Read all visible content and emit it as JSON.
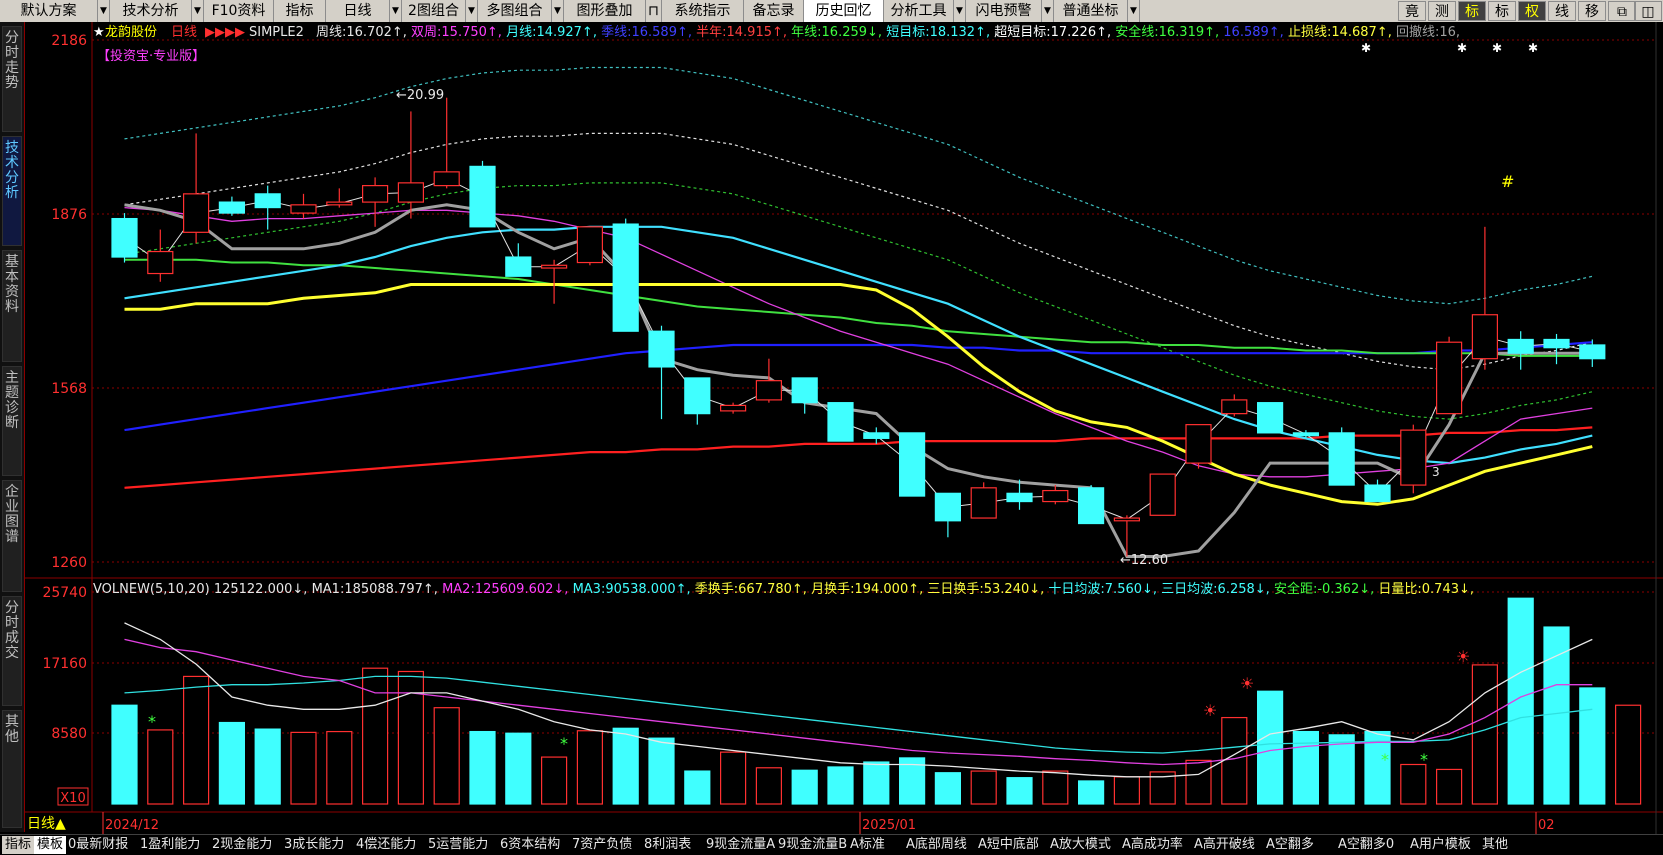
{
  "toolbar": {
    "items": [
      "默认方案",
      "技术分析",
      "F10资料",
      "指标",
      "日线",
      "2图组合",
      "多图组合",
      "图形叠加",
      "系统指示",
      "备忘录",
      "历史回忆",
      "分析工具",
      "闪电预警",
      "普通坐标"
    ],
    "lock_icon": "lock-icon",
    "right_items": [
      "竟",
      "测",
      "标",
      "标",
      "权",
      "线",
      "移"
    ],
    "restore_icon": "restore-icon",
    "split_icon": "split-icon"
  },
  "left_nav": [
    "分时走势",
    "技术分析",
    "基本资料",
    "主题诊断",
    "企业图谱",
    "分时成交",
    "其他"
  ],
  "stock": {
    "name": "龙韵股份",
    "period": "日线",
    "flags": "▶▶▶▶",
    "indicator": "SIMPLE2",
    "badge": "【投资宝·专业版】"
  },
  "upper_legend": [
    {
      "label": "周线",
      "value": "16.702",
      "dir": "↑",
      "color": "#e8e8e8"
    },
    {
      "label": "双周",
      "value": "15.750",
      "dir": "↑",
      "color": "#ff40ff"
    },
    {
      "label": "月线",
      "value": "14.927",
      "dir": "↑",
      "color": "#40ffff"
    },
    {
      "label": "季线",
      "value": "16.589",
      "dir": "↑",
      "color": "#4040ff"
    },
    {
      "label": "半年",
      "value": "14.915",
      "dir": "↑",
      "color": "#ff4040"
    },
    {
      "label": "年线",
      "value": "16.259",
      "dir": "↓",
      "color": "#40ff40"
    },
    {
      "label": "短目标",
      "value": "18.132",
      "dir": "↑",
      "color": "#40ffff"
    },
    {
      "label": "超短目标",
      "value": "17.226",
      "dir": "↑",
      "color": "#ffffff"
    },
    {
      "label": "安全线",
      "value": "16.319",
      "dir": "↑",
      "color": "#40ff40"
    },
    {
      "label": "",
      "value": "16.589",
      "dir": "↑",
      "color": "#4040ff"
    },
    {
      "label": "止损线",
      "value": "14.687",
      "dir": "↑",
      "color": "#ffff40"
    },
    {
      "label": "回撤线",
      "value": "16",
      "dir": "",
      "color": "#a0a0a0"
    }
  ],
  "lower_legend": [
    {
      "label": "VOLNEW(5,10,20)",
      "value": "",
      "dir": "",
      "color": "#e8e8e8"
    },
    {
      "label": "",
      "value": "125122.000",
      "dir": "↓",
      "color": "#e8e8e8"
    },
    {
      "label": "MA1",
      "value": "185088.797",
      "dir": "↑",
      "color": "#e8e8e8"
    },
    {
      "label": "MA2",
      "value": "125609.602",
      "dir": "↓",
      "color": "#ff40ff"
    },
    {
      "label": "MA3",
      "value": "90538.000",
      "dir": "↑",
      "color": "#40ffff"
    },
    {
      "label": "季换手",
      "value": "667.780",
      "dir": "↑",
      "color": "#ffff40"
    },
    {
      "label": "月换手",
      "value": "194.000",
      "dir": "↑",
      "color": "#ffff40"
    },
    {
      "label": "三日换手",
      "value": "53.240",
      "dir": "↓",
      "color": "#ffff40"
    },
    {
      "label": "十日均波",
      "value": "7.560",
      "dir": "↓",
      "color": "#40ffff"
    },
    {
      "label": "三日均波",
      "value": "6.258",
      "dir": "↓",
      "color": "#40ffff"
    },
    {
      "label": "安全距",
      "value": "-0.362",
      "dir": "↓",
      "color": "#40ff40"
    },
    {
      "label": "日量比",
      "value": "0.743",
      "dir": "↓",
      "color": "#ffff40"
    }
  ],
  "axis": {
    "price_ticks": [
      "2186",
      "1876",
      "1568",
      "1260"
    ],
    "volume_ticks": [
      "25740",
      "17160",
      "8580"
    ],
    "volume_unit": "X10",
    "period_label": "日线▲",
    "date_labels": [
      "2024/12",
      "2025/01",
      "02"
    ]
  },
  "annotations": {
    "high": "20.99",
    "low": "12.60",
    "count": "3",
    "hash": "#"
  },
  "colors": {
    "up": "#ff3030",
    "down": "#40ffff",
    "grid": "#8b0000",
    "axis_text": "#ff3030"
  },
  "chart_data": {
    "type": "candlestick",
    "price_range": [
      12.5,
      22.0
    ],
    "volume_range": [
      0,
      26000
    ],
    "candles": [
      {
        "o": 18.75,
        "h": 18.85,
        "l": 17.95,
        "c": 18.05
      },
      {
        "o": 17.75,
        "h": 18.55,
        "l": 17.6,
        "c": 18.15
      },
      {
        "o": 18.5,
        "h": 20.3,
        "l": 18.3,
        "c": 19.2
      },
      {
        "o": 19.05,
        "h": 19.15,
        "l": 18.8,
        "c": 18.85
      },
      {
        "o": 19.2,
        "h": 19.35,
        "l": 18.55,
        "c": 18.95
      },
      {
        "o": 18.85,
        "h": 19.2,
        "l": 18.75,
        "c": 19.0
      },
      {
        "o": 19.0,
        "h": 19.3,
        "l": 18.95,
        "c": 19.05
      },
      {
        "o": 19.05,
        "h": 19.5,
        "l": 18.6,
        "c": 19.35
      },
      {
        "o": 19.05,
        "h": 20.7,
        "l": 18.75,
        "c": 19.4
      },
      {
        "o": 19.35,
        "h": 20.95,
        "l": 19.3,
        "c": 19.6
      },
      {
        "o": 19.7,
        "h": 19.8,
        "l": 18.8,
        "c": 18.6
      },
      {
        "o": 18.05,
        "h": 18.3,
        "l": 17.7,
        "c": 17.7
      },
      {
        "o": 17.85,
        "h": 18.0,
        "l": 17.2,
        "c": 17.9
      },
      {
        "o": 17.95,
        "h": 18.6,
        "l": 17.9,
        "c": 18.6
      },
      {
        "o": 18.65,
        "h": 18.75,
        "l": 16.7,
        "c": 16.7
      },
      {
        "o": 16.7,
        "h": 16.8,
        "l": 15.1,
        "c": 16.05
      },
      {
        "o": 15.85,
        "h": 15.85,
        "l": 15.0,
        "c": 15.2
      },
      {
        "o": 15.25,
        "h": 15.4,
        "l": 15.2,
        "c": 15.35
      },
      {
        "o": 15.45,
        "h": 16.2,
        "l": 15.4,
        "c": 15.8
      },
      {
        "o": 15.85,
        "h": 15.85,
        "l": 15.2,
        "c": 15.4
      },
      {
        "o": 15.4,
        "h": 15.4,
        "l": 14.7,
        "c": 14.7
      },
      {
        "o": 14.85,
        "h": 14.95,
        "l": 14.65,
        "c": 14.75
      },
      {
        "o": 14.85,
        "h": 14.85,
        "l": 13.7,
        "c": 13.7
      },
      {
        "o": 13.75,
        "h": 13.75,
        "l": 12.95,
        "c": 13.25
      },
      {
        "o": 13.3,
        "h": 13.95,
        "l": 13.3,
        "c": 13.85
      },
      {
        "o": 13.75,
        "h": 14.0,
        "l": 13.45,
        "c": 13.6
      },
      {
        "o": 13.6,
        "h": 13.9,
        "l": 13.55,
        "c": 13.8
      },
      {
        "o": 13.85,
        "h": 13.9,
        "l": 13.2,
        "c": 13.2
      },
      {
        "o": 13.25,
        "h": 13.35,
        "l": 12.6,
        "c": 13.3
      },
      {
        "o": 13.35,
        "h": 14.1,
        "l": 13.35,
        "c": 14.1
      },
      {
        "o": 14.3,
        "h": 15.0,
        "l": 14.2,
        "c": 15.0
      },
      {
        "o": 15.2,
        "h": 15.55,
        "l": 15.15,
        "c": 15.45
      },
      {
        "o": 15.4,
        "h": 15.4,
        "l": 14.85,
        "c": 14.85
      },
      {
        "o": 14.85,
        "h": 14.9,
        "l": 14.75,
        "c": 14.8
      },
      {
        "o": 14.85,
        "h": 14.95,
        "l": 13.9,
        "c": 13.9
      },
      {
        "o": 13.9,
        "h": 14.0,
        "l": 13.7,
        "c": 13.6
      },
      {
        "o": 13.9,
        "h": 15.0,
        "l": 13.75,
        "c": 14.9
      },
      {
        "o": 15.2,
        "h": 16.6,
        "l": 15.2,
        "c": 16.5
      },
      {
        "o": 16.2,
        "h": 18.6,
        "l": 16.0,
        "c": 17.0
      },
      {
        "o": 16.55,
        "h": 16.7,
        "l": 16.0,
        "c": 16.3
      },
      {
        "o": 16.55,
        "h": 16.65,
        "l": 16.1,
        "c": 16.4
      },
      {
        "o": 16.45,
        "h": 16.55,
        "l": 16.05,
        "c": 16.2
      }
    ],
    "volumes": [
      12000,
      9000,
      15500,
      9900,
      9100,
      8700,
      8800,
      16500,
      16100,
      11700,
      8800,
      8600,
      5700,
      8900,
      9200,
      8000,
      4000,
      6300,
      4400,
      4100,
      4500,
      5100,
      5600,
      3800,
      4000,
      3200,
      4000,
      2800,
      3300,
      3900,
      5300,
      10500,
      13700,
      8800,
      8400,
      8800,
      4800,
      4200,
      16900,
      25000,
      21500,
      14100,
      12000
    ],
    "ma_weekly": [
      19.0,
      18.9,
      18.7,
      18.2,
      18.2,
      18.2,
      18.3,
      18.5,
      18.9,
      19.0,
      18.9,
      18.5,
      18.2,
      18.4,
      17.7,
      16.2,
      16.0,
      15.9,
      15.85,
      15.4,
      15.3,
      15.2,
      14.6,
      14.2,
      14.05,
      13.95,
      13.9,
      13.85,
      12.6,
      12.6,
      12.7,
      13.4,
      14.3,
      14.3,
      14.3,
      14.3,
      14.0,
      15.0,
      16.3,
      16.3,
      16.3,
      16.3
    ],
    "ma_biweekly": [
      18.95,
      18.9,
      18.8,
      18.7,
      18.75,
      18.75,
      18.8,
      18.85,
      18.9,
      18.9,
      18.85,
      18.8,
      18.7,
      18.55,
      18.4,
      18.1,
      17.8,
      17.5,
      17.2,
      16.95,
      16.7,
      16.5,
      16.3,
      16.1,
      15.8,
      15.5,
      15.2,
      14.95,
      14.7,
      14.5,
      14.25,
      14.1,
      14.05,
      14.05,
      14.1,
      14.15,
      14.2,
      14.3,
      14.7,
      15.1,
      15.2,
      15.3
    ],
    "ma_monthly": [
      17.3,
      17.4,
      17.5,
      17.6,
      17.7,
      17.8,
      17.9,
      18.05,
      18.25,
      18.4,
      18.5,
      18.55,
      18.55,
      18.6,
      18.6,
      18.6,
      18.5,
      18.4,
      18.2,
      18.0,
      17.8,
      17.6,
      17.4,
      17.2,
      16.9,
      16.6,
      16.35,
      16.1,
      15.85,
      15.6,
      15.35,
      15.1,
      14.9,
      14.75,
      14.6,
      14.45,
      14.35,
      14.3,
      14.4,
      14.55,
      14.65,
      14.8
    ],
    "ma_quarter": [
      14.9,
      15.0,
      15.1,
      15.2,
      15.3,
      15.4,
      15.5,
      15.6,
      15.7,
      15.8,
      15.9,
      16.0,
      16.1,
      16.2,
      16.3,
      16.35,
      16.4,
      16.45,
      16.45,
      16.45,
      16.45,
      16.45,
      16.45,
      16.4,
      16.4,
      16.35,
      16.35,
      16.3,
      16.3,
      16.3,
      16.3,
      16.3,
      16.3,
      16.3,
      16.3,
      16.3,
      16.3,
      16.35,
      16.35,
      16.4,
      16.45,
      16.5
    ],
    "ma_halfyear": [
      13.85,
      13.9,
      13.95,
      14.0,
      14.05,
      14.1,
      14.15,
      14.2,
      14.25,
      14.3,
      14.35,
      14.4,
      14.45,
      14.5,
      14.5,
      14.55,
      14.55,
      14.6,
      14.6,
      14.65,
      14.65,
      14.65,
      14.7,
      14.7,
      14.7,
      14.7,
      14.7,
      14.75,
      14.75,
      14.75,
      14.75,
      14.75,
      14.75,
      14.75,
      14.8,
      14.8,
      14.8,
      14.85,
      14.85,
      14.9,
      14.9,
      14.95
    ],
    "ma_year": [
      18.0,
      18.0,
      18.0,
      17.95,
      17.95,
      17.9,
      17.9,
      17.85,
      17.8,
      17.75,
      17.7,
      17.65,
      17.55,
      17.45,
      17.35,
      17.25,
      17.15,
      17.1,
      17.05,
      17.0,
      16.95,
      16.85,
      16.8,
      16.7,
      16.65,
      16.6,
      16.55,
      16.5,
      16.5,
      16.45,
      16.45,
      16.4,
      16.4,
      16.35,
      16.35,
      16.3,
      16.3,
      16.3,
      16.3,
      16.25,
      16.25,
      16.25
    ],
    "stop_loss": [
      17.1,
      17.1,
      17.2,
      17.2,
      17.2,
      17.3,
      17.35,
      17.4,
      17.55,
      17.55,
      17.55,
      17.55,
      17.55,
      17.55,
      17.55,
      17.55,
      17.55,
      17.55,
      17.55,
      17.55,
      17.55,
      17.45,
      17.1,
      16.6,
      16.05,
      15.6,
      15.25,
      15.05,
      14.95,
      14.7,
      14.4,
      14.1,
      13.9,
      13.75,
      13.6,
      13.55,
      13.65,
      13.9,
      14.15,
      14.3,
      14.45,
      14.6
    ],
    "vol_ma5": [
      22000,
      20000,
      17000,
      13000,
      12000,
      11500,
      11500,
      12000,
      13500,
      13500,
      12500,
      11500,
      10000,
      9000,
      8500,
      7500,
      7000,
      6500,
      6000,
      5500,
      5000,
      4800,
      4800,
      4600,
      4300,
      4000,
      3800,
      3500,
      3300,
      3300,
      3600,
      6000,
      8500,
      9200,
      10000,
      8500,
      7800,
      10000,
      13500,
      16000,
      18000,
      20000
    ],
    "vol_ma10": [
      20000,
      19000,
      18500,
      17500,
      16500,
      15500,
      15000,
      13500,
      13500,
      13000,
      12500,
      12000,
      11500,
      11000,
      10500,
      10000,
      9500,
      9000,
      8500,
      8000,
      7500,
      7000,
      6500,
      6200,
      6000,
      5800,
      5500,
      5300,
      5000,
      4800,
      5000,
      5500,
      6500,
      7000,
      7300,
      7500,
      7500,
      8500,
      10500,
      13000,
      14500,
      14500
    ],
    "vol_ma20": [
      13500,
      13800,
      14200,
      14500,
      14500,
      14700,
      15000,
      15500,
      15500,
      15300,
      14800,
      14300,
      13800,
      13300,
      12800,
      12300,
      11800,
      11300,
      10800,
      10300,
      9800,
      9300,
      8800,
      8300,
      7800,
      7300,
      6800,
      6500,
      6300,
      6200,
      6500,
      6900,
      7300,
      7400,
      7500,
      7600,
      7600,
      7800,
      9000,
      10500,
      11000,
      11500
    ]
  },
  "bottom_tabs": {
    "first": [
      "指标",
      "模板"
    ],
    "tabs": [
      "0最新财报",
      "1盈利能力",
      "2现金能力",
      "3成长能力",
      "4偿还能力",
      "5运营能力",
      "6资本结构",
      "7资产负债",
      "8利润表",
      "9现金流量A",
      "9现金流量B",
      "A标准",
      "A底部周线",
      "A短中底部",
      "A放大模式",
      "A高成功率",
      "A高开破线",
      "A空翻多",
      "A空翻多0",
      "A用户模板",
      "其他"
    ]
  }
}
